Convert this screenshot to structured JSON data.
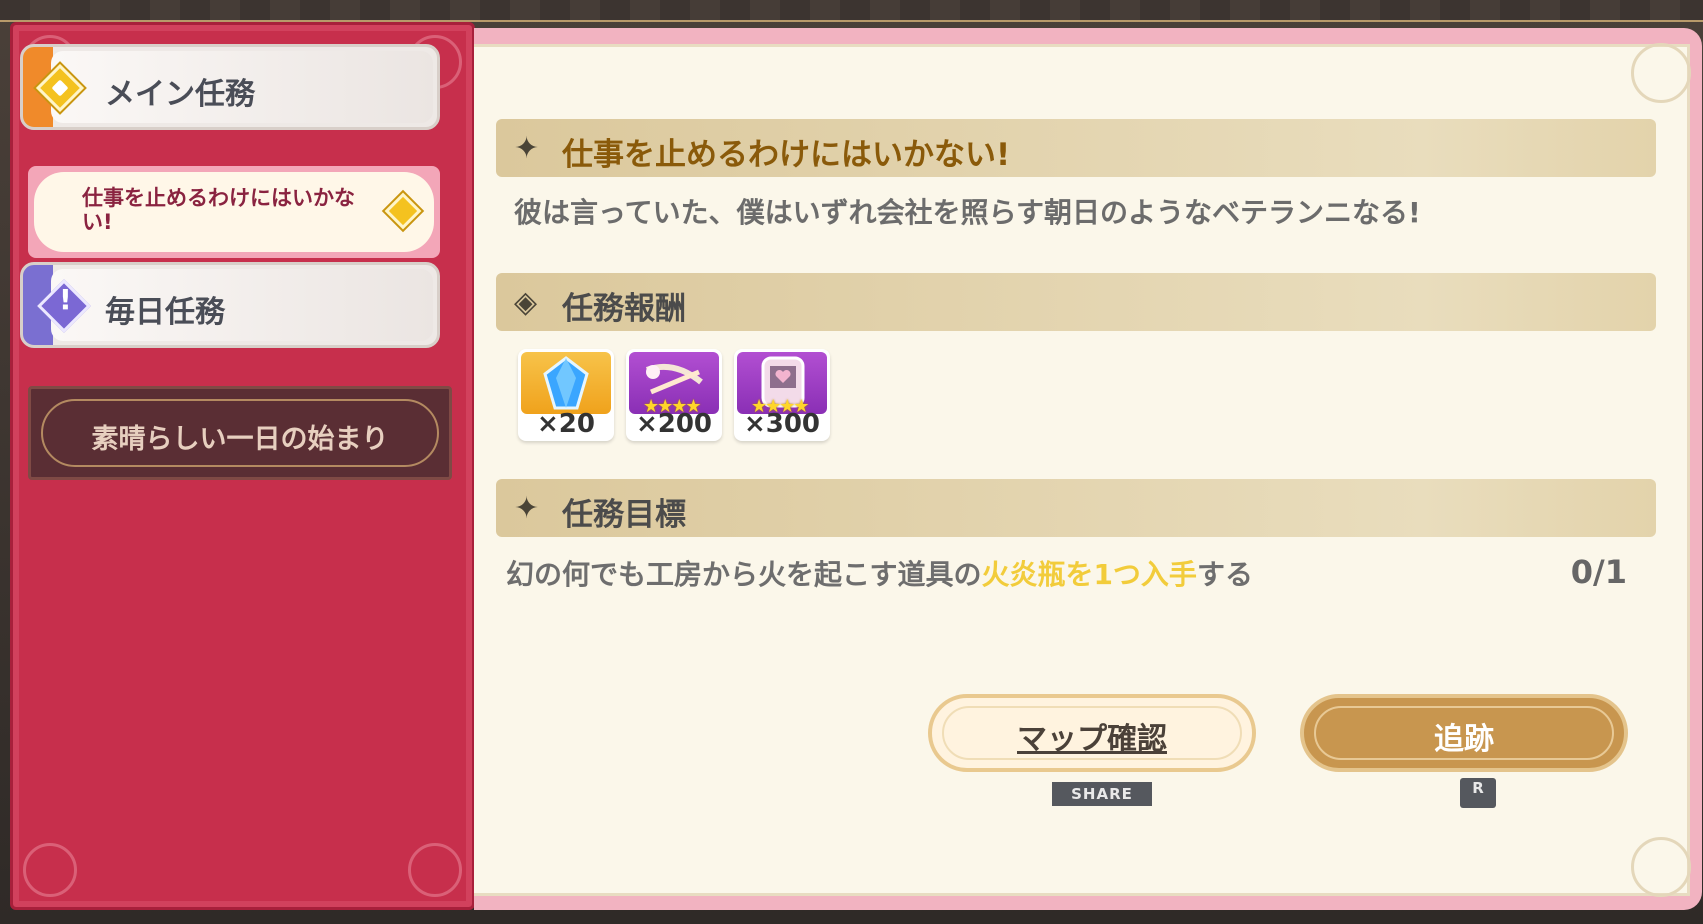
{
  "sidebar": {
    "tabs": [
      {
        "label": "メイン任務",
        "icon": "diamond-quest-icon",
        "accent": "#f08a2a"
      },
      {
        "label": "毎日任務",
        "icon": "exclamation-icon",
        "accent": "#7a6fd1"
      }
    ],
    "subtabs": [
      {
        "label": "仕事を止めるわけにはいかない!",
        "selected": true
      },
      {
        "label": "素晴らしい一日の始まり",
        "selected": false
      }
    ]
  },
  "quest": {
    "title": "仕事を止めるわけにはいかない!",
    "description": "彼は言っていた、僕はいずれ会社を照らす朝日のようなベテランニなる!",
    "rewards_header": "任務報酬",
    "rewards": [
      {
        "icon": "blue-crystal-icon",
        "quantity": "×20"
      },
      {
        "icon": "crossbow-icon",
        "quantity": "×200",
        "stars": "★★★★"
      },
      {
        "icon": "device-card-icon",
        "quantity": "×300",
        "stars": "★★★★"
      }
    ],
    "objective_header": "任務目標",
    "objective": {
      "prefix": "幻の何でも工房から火を起こす道具の",
      "highlight": "火炎瓶を1つ入手",
      "suffix": "する",
      "progress": "0/1"
    }
  },
  "buttons": {
    "map_label": "マップ確認",
    "map_hint": "SHARE",
    "track_label": "追跡",
    "track_hint": "R"
  },
  "colors": {
    "sidebar_bg": "#c72f4c",
    "panel_bg": "#fbf7ea",
    "highlight": "#f2cc3b",
    "title_text": "#8a5a0a"
  }
}
